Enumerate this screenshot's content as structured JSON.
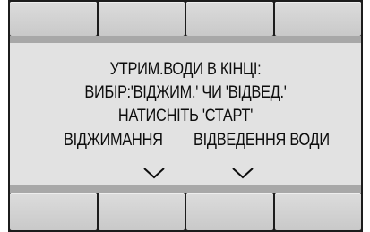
{
  "screen": {
    "line1": "УТРИМ.ВОДИ В КІНЦІ:",
    "line2": "ВИБІР:'ВІДЖИМ.' ЧИ 'ВІДВЕД.'",
    "line3": "НАТИСНІТЬ 'СТАРТ'",
    "option_spin": "ВІДЖИМАННЯ",
    "option_drain": "ВІДВЕДЕННЯ ВОДИ"
  },
  "icons": {
    "spin_selector": "chevron-down-icon",
    "drain_selector": "chevron-down-icon"
  },
  "colors": {
    "bezel": "#1c1c1c",
    "screen_bg": "#e2e2e2",
    "button_bg": "#d4d4d4",
    "text": "#0d0d0d"
  }
}
